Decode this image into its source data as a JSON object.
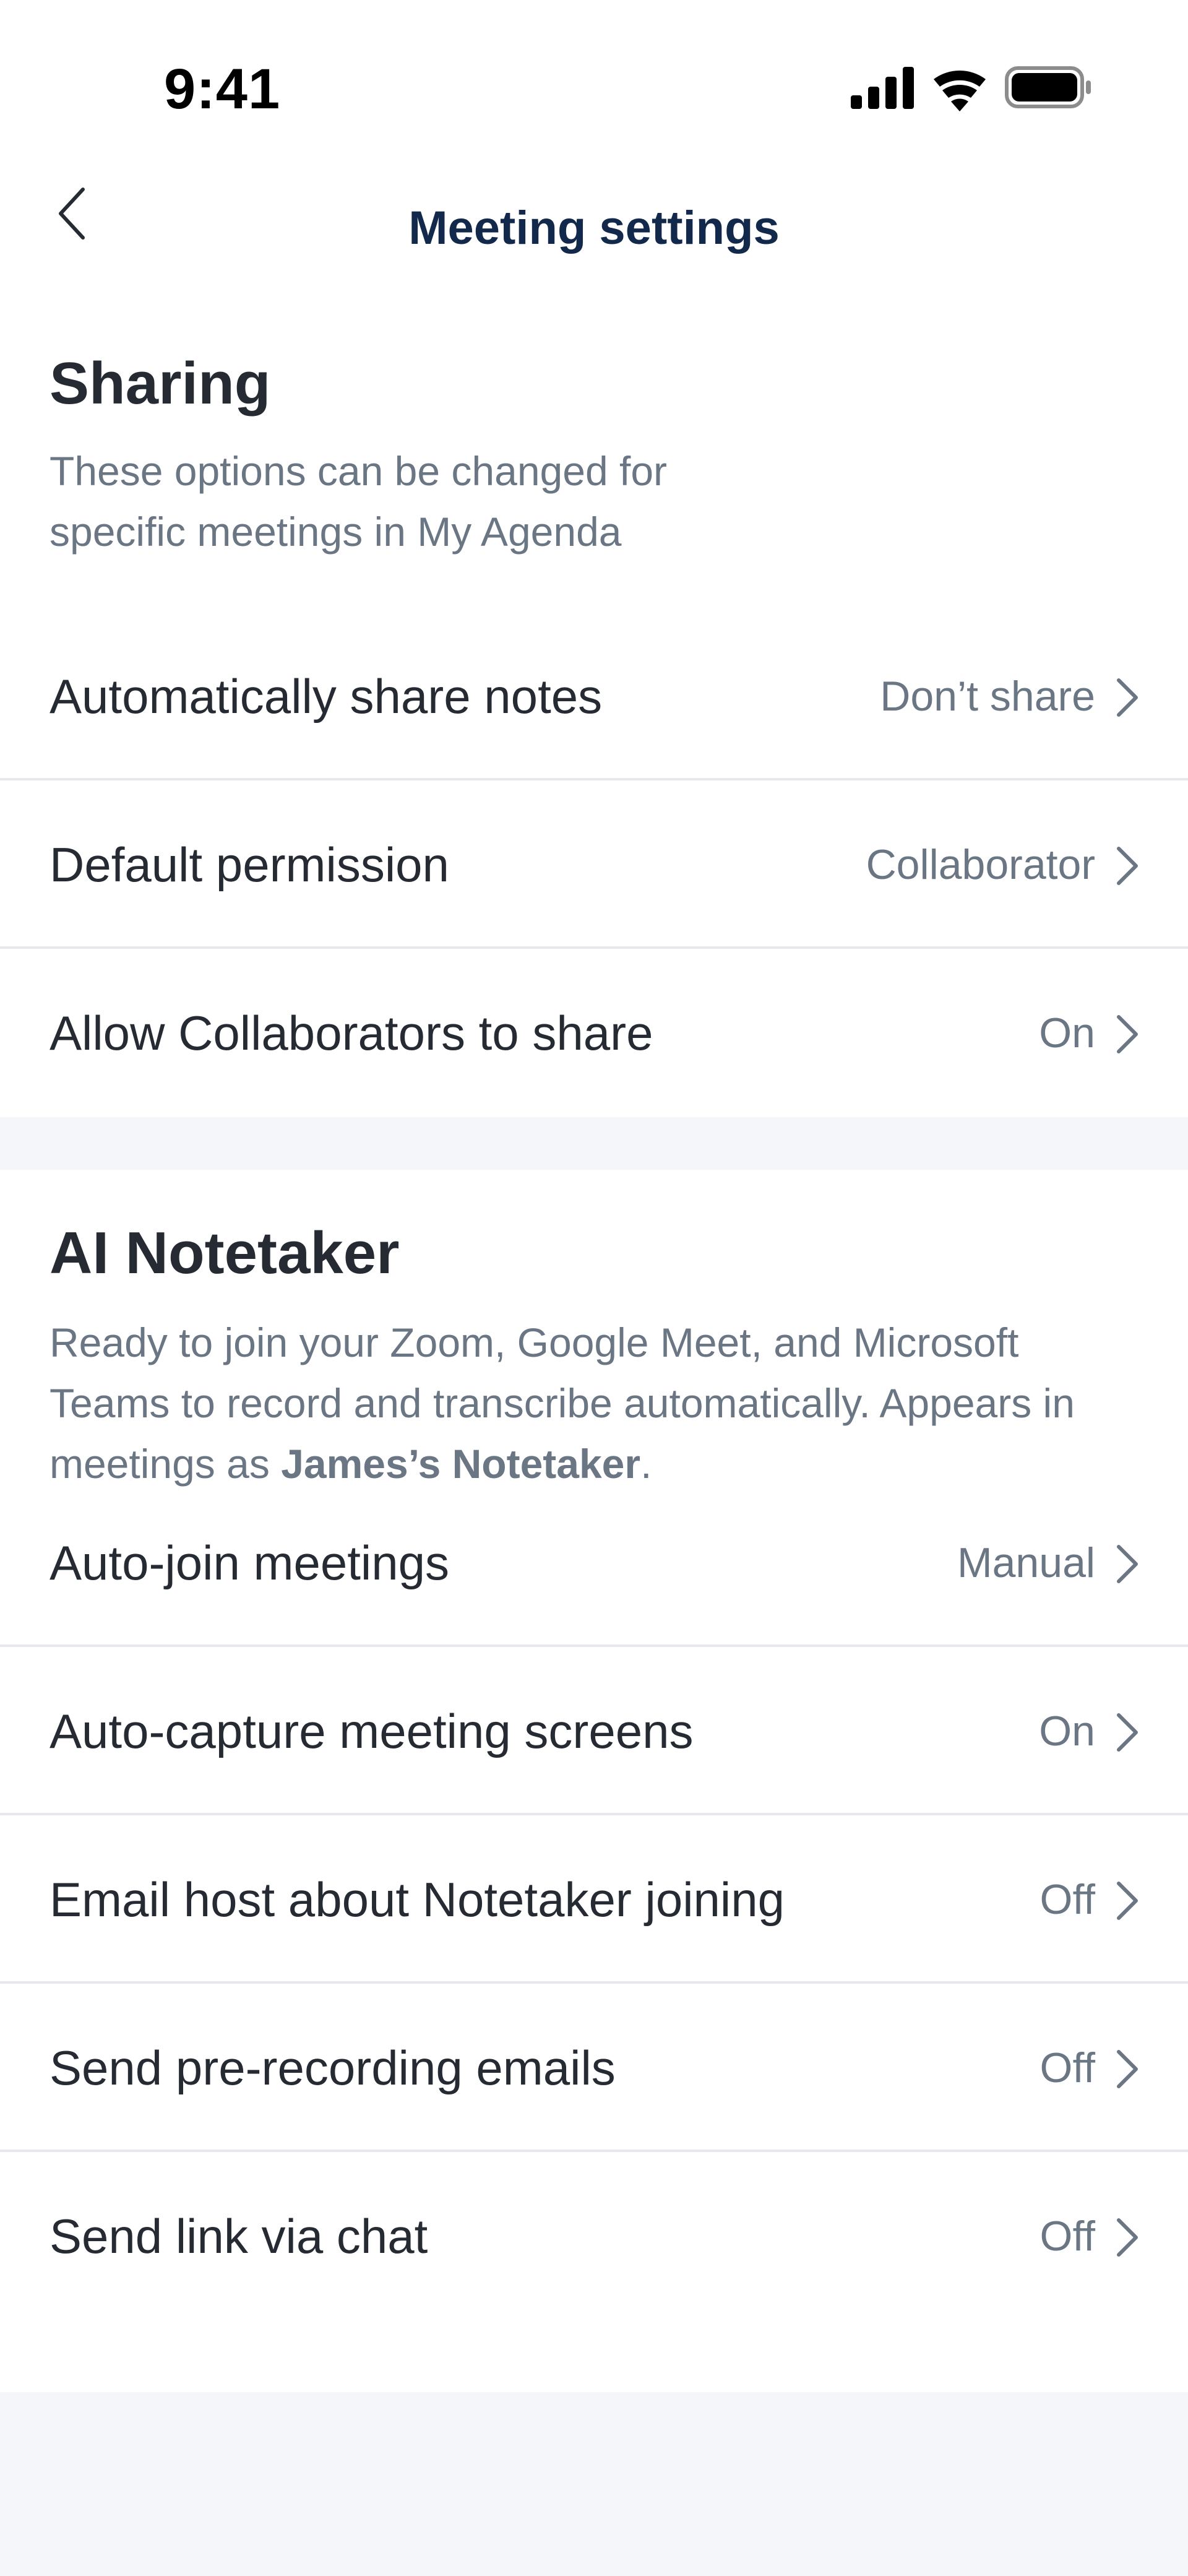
{
  "status_bar": {
    "time": "9:41",
    "icons": [
      "cellular-signal-icon",
      "wifi-icon",
      "battery-icon"
    ]
  },
  "header": {
    "title": "Meeting settings",
    "back_icon": "chevron-left-icon"
  },
  "sharing": {
    "title": "Sharing",
    "description": "These options can be changed for specific meetings in My Agenda",
    "rows": [
      {
        "label": "Automatically share notes",
        "value": "Don’t share"
      },
      {
        "label": "Default permission",
        "value": "Collaborator"
      },
      {
        "label": "Allow Collaborators to share",
        "value": "On"
      }
    ]
  },
  "ai_notetaker": {
    "title": "AI Notetaker",
    "description_lead": "Ready to join your Zoom, Google Meet, and Microsoft Teams to record and transcribe automatically. Appears in meetings as ",
    "description_name": "James’s Notetaker",
    "description_end": ".",
    "rows": [
      {
        "label": "Auto-join meetings",
        "value": "Manual"
      },
      {
        "label": "Auto-capture meeting screens",
        "value": "On"
      },
      {
        "label": "Email host about Notetaker joining",
        "value": "Off"
      },
      {
        "label": "Send pre-recording emails",
        "value": "Off"
      },
      {
        "label": "Send link via chat",
        "value": "Off"
      }
    ]
  },
  "colors": {
    "title": "#13294b",
    "text": "#262b33",
    "muted": "#6b7684",
    "divider": "#e6e8ec",
    "background": "#f5f6fa"
  }
}
